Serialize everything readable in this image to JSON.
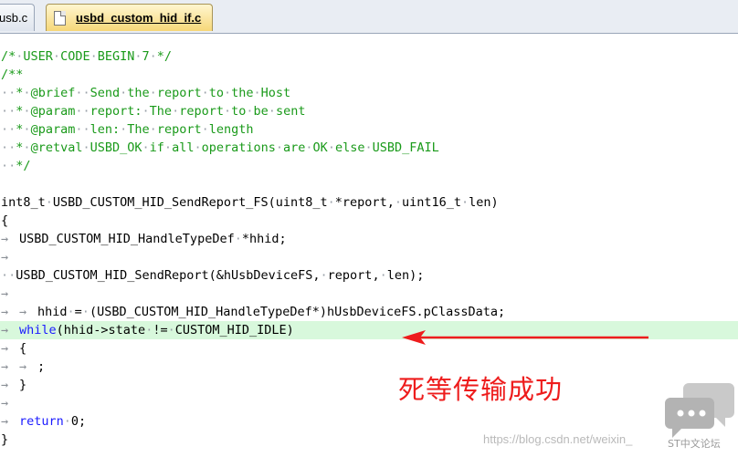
{
  "tabs": [
    {
      "label": "usb.c",
      "active": false
    },
    {
      "label": "usbd_custom_hid_if.c",
      "active": true
    }
  ],
  "code_lines": [
    {
      "text": "/*·USER·CODE·BEGIN·7·*/",
      "kind": "comment"
    },
    {
      "text": "/**",
      "kind": "comment"
    },
    {
      "text": "··*·@brief··Send·the·report·to·the·Host",
      "kind": "comment"
    },
    {
      "text": "··*·@param··report:·The·report·to·be·sent",
      "kind": "comment"
    },
    {
      "text": "··*·@param··len:·The·report·length",
      "kind": "comment"
    },
    {
      "text": "··*·@retval·USBD_OK·if·all·operations·are·OK·else·USBD_FAIL",
      "kind": "comment"
    },
    {
      "text": "··*/",
      "kind": "comment"
    },
    {
      "text": "",
      "kind": "plain"
    },
    {
      "text": "int8_t·USBD_CUSTOM_HID_SendReport_FS(uint8_t·*report,·uint16_t·len)",
      "kind": "plain"
    },
    {
      "text": "{",
      "kind": "plain"
    },
    {
      "text": "→USBD_CUSTOM_HID_HandleTypeDef·*hhid;",
      "kind": "plain"
    },
    {
      "text": "→",
      "kind": "plain"
    },
    {
      "text": "··USBD_CUSTOM_HID_SendReport(&hUsbDeviceFS,·report,·len);",
      "kind": "plain"
    },
    {
      "text": "→",
      "kind": "plain"
    },
    {
      "text": "→→hhid·=·(USBD_CUSTOM_HID_HandleTypeDef*)hUsbDeviceFS.pClassData;",
      "kind": "plain"
    },
    {
      "text": "→while(hhid->state·!=·CUSTOM_HID_IDLE)",
      "kind": "plain",
      "highlight": true,
      "keyword": "while"
    },
    {
      "text": "→{",
      "kind": "plain"
    },
    {
      "text": "→→;",
      "kind": "plain"
    },
    {
      "text": "→}",
      "kind": "plain"
    },
    {
      "text": "→",
      "kind": "plain"
    },
    {
      "text": "→return·0;",
      "kind": "plain",
      "keyword": "return"
    },
    {
      "text": "}",
      "kind": "plain"
    }
  ],
  "annotation": "死等传输成功",
  "watermark": {
    "url": "https://blog.csdn.net/weixin_",
    "logo_text": "ST中文论坛"
  },
  "colors": {
    "comment": "#1a9a1a",
    "keyword": "#1a1aff",
    "highlight": "#d8f8dc",
    "arrow": "#ee1c1c"
  },
  "icons": {
    "tab_file": "file-icon"
  }
}
